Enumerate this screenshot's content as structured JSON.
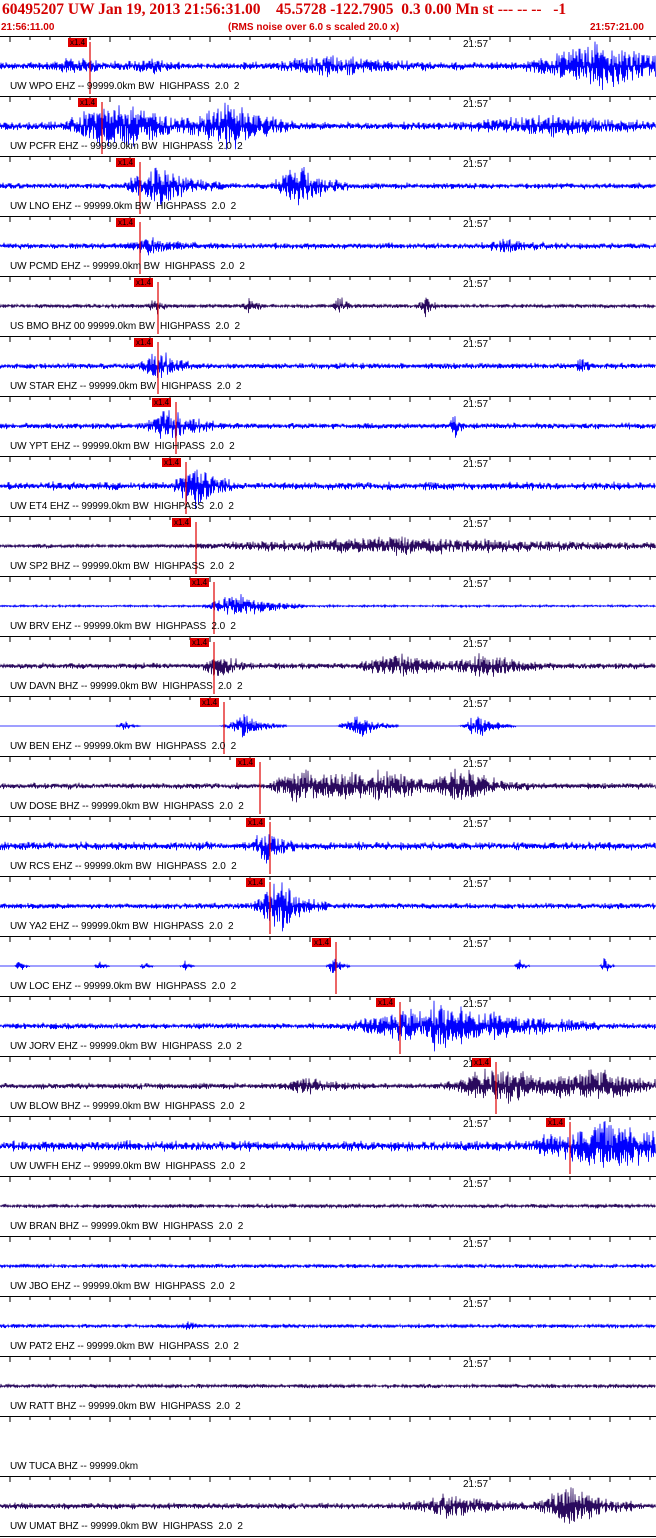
{
  "header": {
    "title": "60495207 UW Jan 19, 2013 21:56:31.00    45.5728 -122.7905  0.3 0.00 Mn st --- -- --   -1",
    "start_time": "21:56:11.00",
    "rms_note": "(RMS noise over 6.0 s scaled 20.0 x)",
    "end_time": "21:57:21.00"
  },
  "colors": {
    "header_text": "#d40000",
    "trace_blue": "#0000ff",
    "trace_dark": "#2a0a5e",
    "pick_marker": "#e00000"
  },
  "time_tick_label": "21:57",
  "scale_tag_text": "x1.4",
  "traces": [
    {
      "label": "UW WPO EHZ -- 99999.0km BW  HIGHPASS  2.0  2",
      "color": "trace_blue",
      "tag": "x1.4",
      "time_label": "21:57"
    },
    {
      "label": "UW PCFR EHZ -- 99999.0km BW  HIGHPASS  2.0  2",
      "color": "trace_blue",
      "tag": "x1.4",
      "time_label": "21:57"
    },
    {
      "label": "UW LNO EHZ -- 99999.0km BW  HIGHPASS  2.0  2",
      "color": "trace_blue",
      "tag": "x1.4",
      "time_label": "21:57"
    },
    {
      "label": "UW PCMD EHZ -- 99999.0km BW  HIGHPASS  2.0  2",
      "color": "trace_blue",
      "tag": "x1.4",
      "time_label": "21:57"
    },
    {
      "label": "US BMO BHZ 00 99999.0km BW  HIGHPASS  2.0  2",
      "color": "trace_dark",
      "tag": "x1.4",
      "time_label": "21:57"
    },
    {
      "label": "UW STAR EHZ -- 99999.0km BW  HIGHPASS  2.0  2",
      "color": "trace_blue",
      "tag": "x1.4",
      "time_label": "21:57"
    },
    {
      "label": "UW YPT EHZ -- 99999.0km BW  HIGHPASS  2.0  2",
      "color": "trace_blue",
      "tag": "x1.4",
      "time_label": "21:57"
    },
    {
      "label": "UW ET4 EHZ -- 99999.0km BW  HIGHPASS  2.0  2",
      "color": "trace_blue",
      "tag": "x1.4",
      "time_label": "21:57"
    },
    {
      "label": "UW SP2 BHZ -- 99999.0km BW  HIGHPASS  2.0  2",
      "color": "trace_dark",
      "tag": "x1.4",
      "time_label": "21:57"
    },
    {
      "label": "UW BRV EHZ -- 99999.0km BW  HIGHPASS  2.0  2",
      "color": "trace_blue",
      "tag": "x1.4",
      "time_label": "21:57"
    },
    {
      "label": "UW DAVN BHZ -- 99999.0km BW  HIGHPASS  2.0  2",
      "color": "trace_dark",
      "tag": "x1.4",
      "time_label": "21:57"
    },
    {
      "label": "UW BEN EHZ -- 99999.0km BW  HIGHPASS  2.0  2",
      "color": "trace_blue",
      "tag": "x1.4",
      "time_label": "21:57"
    },
    {
      "label": "UW DOSE BHZ -- 99999.0km BW  HIGHPASS  2.0  2",
      "color": "trace_dark",
      "tag": "x1.4",
      "time_label": "21:57"
    },
    {
      "label": "UW RCS EHZ -- 99999.0km BW  HIGHPASS  2.0  2",
      "color": "trace_blue",
      "tag": "x1.4",
      "time_label": "21:57"
    },
    {
      "label": "UW YA2 EHZ -- 99999.0km BW  HIGHPASS  2.0  2",
      "color": "trace_blue",
      "tag": "x1.4",
      "time_label": "21:57"
    },
    {
      "label": "UW LOC EHZ -- 99999.0km BW  HIGHPASS  2.0  2",
      "color": "trace_blue",
      "tag": "x1.4",
      "time_label": "21:57"
    },
    {
      "label": "UW JORV EHZ -- 99999.0km BW  HIGHPASS  2.0  2",
      "color": "trace_blue",
      "tag": "x1.4",
      "time_label": "21:57"
    },
    {
      "label": "UW BLOW BHZ -- 99999.0km BW  HIGHPASS  2.0  2",
      "color": "trace_dark",
      "tag": "x1.4",
      "time_label": "21:57"
    },
    {
      "label": "UW UWFH EHZ -- 99999.0km BW  HIGHPASS  2.0  2",
      "color": "trace_blue",
      "tag": "x1.4",
      "time_label": "21:57"
    },
    {
      "label": "UW BRAN BHZ -- 99999.0km BW  HIGHPASS  2.0  2",
      "color": "trace_dark",
      "tag": "",
      "time_label": "21:57"
    },
    {
      "label": "UW JBO EHZ -- 99999.0km BW  HIGHPASS  2.0  2",
      "color": "trace_blue",
      "tag": "",
      "time_label": "21:57"
    },
    {
      "label": "UW PAT2 EHZ -- 99999.0km BW  HIGHPASS  2.0  2",
      "color": "trace_blue",
      "tag": "",
      "time_label": "21:57"
    },
    {
      "label": "UW RATT BHZ -- 99999.0km BW  HIGHPASS  2.0  2",
      "color": "trace_dark",
      "tag": "",
      "time_label": "21:57"
    },
    {
      "label": "UW TUCA BHZ -- 99999.0km",
      "color": "trace_dark",
      "tag": "",
      "time_label": ""
    },
    {
      "label": "UW UMAT BHZ -- 99999.0km BW  HIGHPASS  2.0  2",
      "color": "trace_dark",
      "tag": "",
      "time_label": "21:57"
    }
  ]
}
